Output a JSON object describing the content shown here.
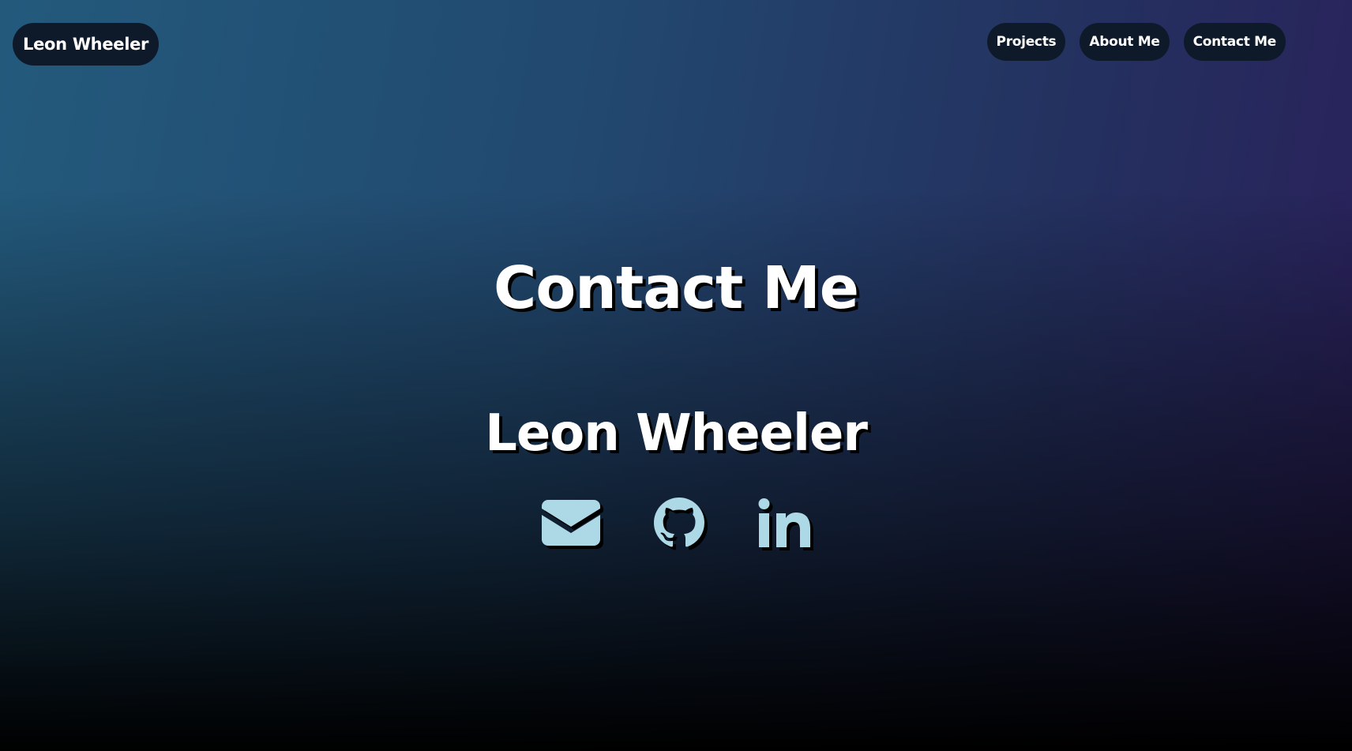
{
  "header": {
    "brand": "Leon Wheeler",
    "nav": [
      {
        "label": "Projects"
      },
      {
        "label": "About Me"
      },
      {
        "label": "Contact Me"
      }
    ]
  },
  "main": {
    "title": "Contact Me",
    "name": "Leon Wheeler",
    "socials": [
      {
        "icon": "envelope-icon"
      },
      {
        "icon": "github-icon"
      },
      {
        "icon": "linkedin-icon"
      }
    ]
  },
  "colors": {
    "icon": "#add8e6",
    "pill_bg": "#0e1a2a",
    "text": "#ffffff"
  }
}
